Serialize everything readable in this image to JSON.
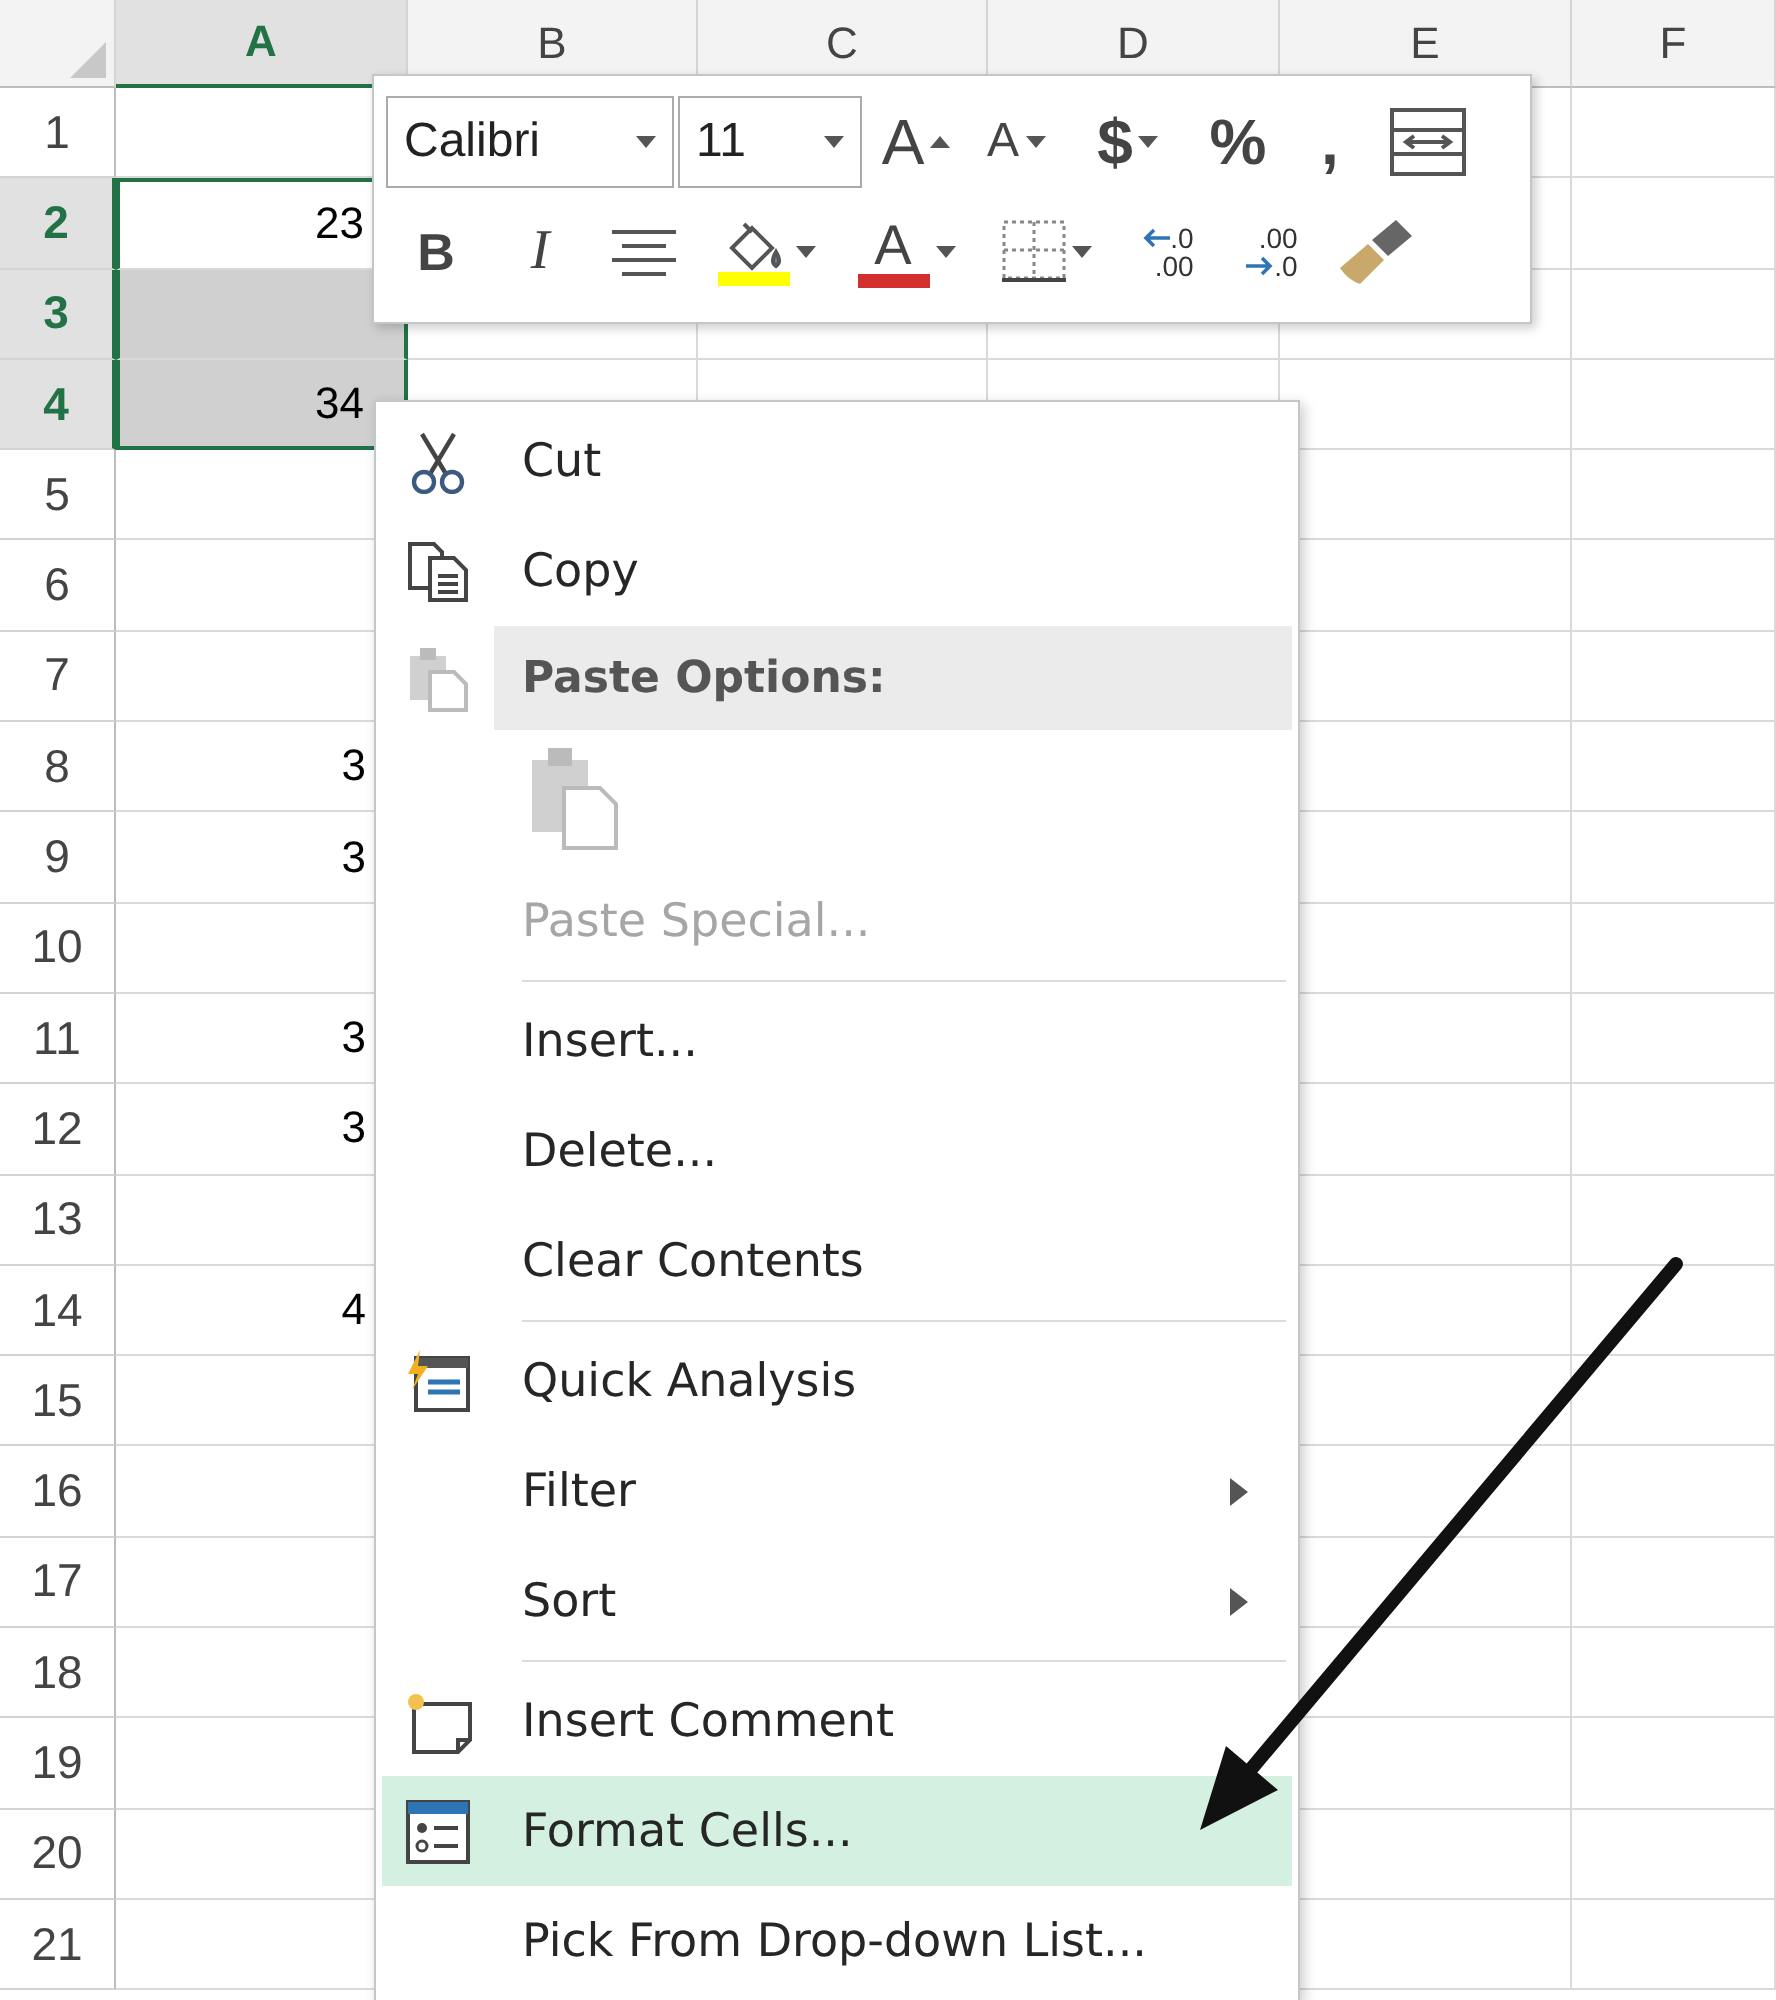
{
  "sheet": {
    "columns": [
      {
        "label": "A",
        "selected": true
      },
      {
        "label": "B",
        "selected": false
      },
      {
        "label": "C",
        "selected": false
      },
      {
        "label": "D",
        "selected": false
      },
      {
        "label": "E",
        "selected": false
      },
      {
        "label": "F",
        "selected": false
      }
    ],
    "rows": [
      {
        "label": "1",
        "selected": false
      },
      {
        "label": "2",
        "selected": true,
        "active": true,
        "value": "23"
      },
      {
        "label": "3",
        "selected": true,
        "active": false
      },
      {
        "label": "4",
        "selected": true,
        "active": false,
        "value": "34"
      },
      {
        "label": "5",
        "selected": false
      },
      {
        "label": "6",
        "selected": false
      },
      {
        "label": "7",
        "selected": false
      },
      {
        "label": "8",
        "selected": false,
        "value": "3"
      },
      {
        "label": "9",
        "selected": false,
        "value": "3"
      },
      {
        "label": "10",
        "selected": false
      },
      {
        "label": "11",
        "selected": false,
        "value": "3"
      },
      {
        "label": "12",
        "selected": false,
        "value": "3"
      },
      {
        "label": "13",
        "selected": false
      },
      {
        "label": "14",
        "selected": false,
        "value": "4"
      },
      {
        "label": "15",
        "selected": false
      },
      {
        "label": "16",
        "selected": false
      },
      {
        "label": "17",
        "selected": false
      },
      {
        "label": "18",
        "selected": false
      },
      {
        "label": "19",
        "selected": false
      },
      {
        "label": "20",
        "selected": false
      },
      {
        "label": "21",
        "selected": false
      }
    ]
  },
  "mini_toolbar": {
    "font_row": {
      "items": [
        {
          "kind": "fontfield",
          "value": "Calibri"
        },
        {
          "kind": "sizefield",
          "value": "11"
        },
        {
          "kind": "grow",
          "label": "A"
        },
        {
          "kind": "shrink",
          "label": "A"
        },
        {
          "kind": "glyph",
          "label": "$",
          "caret": true
        },
        {
          "kind": "glyph",
          "label": "%"
        },
        {
          "kind": "glyph",
          "label": ","
        },
        {
          "kind": "wrap"
        }
      ]
    },
    "format_row": {
      "items": [
        {
          "kind": "bold",
          "label": "B"
        },
        {
          "kind": "italic",
          "label": "I"
        },
        {
          "kind": "align"
        },
        {
          "kind": "fill",
          "color": "#ffff00",
          "caret": true
        },
        {
          "kind": "fontcolor",
          "label": "A",
          "color": "#d32f2f",
          "caret": true
        },
        {
          "kind": "borders",
          "caret": true
        },
        {
          "kind": "incdecimal",
          "lines": [
            ".0",
            ".00"
          ]
        },
        {
          "kind": "decdecimal",
          "lines": [
            ".00",
            ".0"
          ]
        },
        {
          "kind": "painter"
        }
      ]
    }
  },
  "context_menu": {
    "items": [
      {
        "kind": "cut",
        "label": "Cut",
        "disabled": false,
        "selected": false
      },
      {
        "kind": "copy",
        "label": "Copy",
        "disabled": false,
        "selected": false
      },
      {
        "kind": "header",
        "label": "Paste Options:"
      },
      {
        "kind": "pastebutton"
      },
      {
        "kind": "plain",
        "label": "Paste Special...",
        "disabled": true,
        "selected": false
      },
      {
        "kind": "separator"
      },
      {
        "kind": "plain",
        "label": "Insert...",
        "disabled": false,
        "selected": false
      },
      {
        "kind": "plain",
        "label": "Delete...",
        "disabled": false,
        "selected": false
      },
      {
        "kind": "plain",
        "label": "Clear Contents",
        "disabled": false,
        "selected": false
      },
      {
        "kind": "separator"
      },
      {
        "kind": "quick",
        "label": "Quick Analysis",
        "disabled": false,
        "selected": false
      },
      {
        "kind": "submenu",
        "label": "Filter",
        "disabled": false,
        "selected": false
      },
      {
        "kind": "submenu",
        "label": "Sort",
        "disabled": false,
        "selected": false
      },
      {
        "kind": "separator"
      },
      {
        "kind": "comment",
        "label": "Insert Comment",
        "disabled": false,
        "selected": false
      },
      {
        "kind": "format",
        "label": "Format Cells...",
        "disabled": false,
        "selected": true
      },
      {
        "kind": "plain",
        "label": "Pick From Drop-down List...",
        "disabled": false,
        "selected": false
      }
    ]
  }
}
